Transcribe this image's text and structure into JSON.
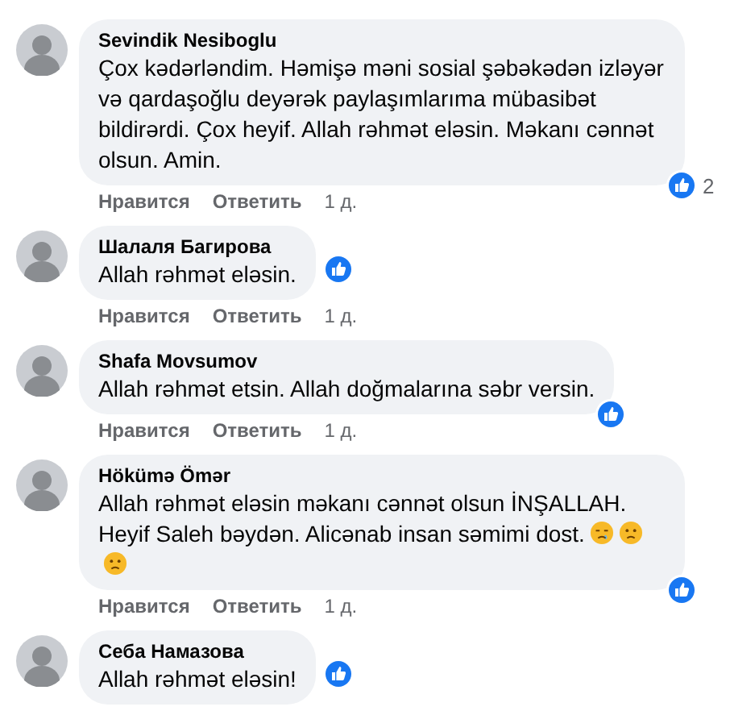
{
  "comments": [
    {
      "author": "Sevindik Nesiboglu",
      "text": "Çox kədərləndim. Həmişə məni sosial şəbəkədən izləyər və qardaşoğlu deyərək paylaşımlarıma mübasibət bildirərdi. Çox heyif. Allah rəhmət eləsin. Məkanı cənnət olsun. Amin.",
      "reaction_count": "2",
      "actions": [
        "Нравится",
        "Ответить"
      ],
      "time": "1 д."
    },
    {
      "author": "Шалаля Багирова",
      "text": "Allah rəhmət eləsin.",
      "actions": [
        "Нравится",
        "Ответить"
      ],
      "time": "1 д."
    },
    {
      "author": "Shafa Movsumov",
      "text": "Allah rəhmət etsin. Allah doğmalarına səbr versin.",
      "actions": [
        "Нравится",
        "Ответить"
      ],
      "time": "1 д."
    },
    {
      "author": "Hökümə Ömər",
      "text": "Allah rəhmət eləsin məkanı cənnət olsun İNŞALLAH. Heyif Saleh bəydən. Alicənab insan səmimi dost.",
      "emojis": [
        {
          "kind": "sleepy"
        },
        {
          "kind": "sad"
        },
        {
          "kind": "sad"
        }
      ],
      "actions": [
        "Нравится",
        "Ответить"
      ],
      "time": "1 д."
    },
    {
      "author": "Себа Намазова",
      "text": "Allah rəhmət eləsin!"
    }
  ]
}
